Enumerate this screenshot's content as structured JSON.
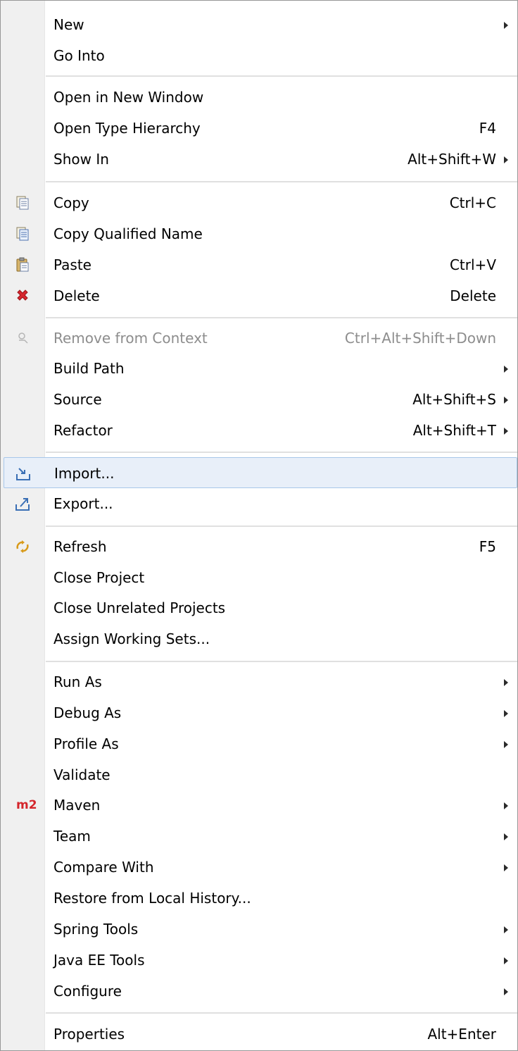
{
  "menu": {
    "items": [
      {
        "label": "New",
        "shortcut": "",
        "submenu": true
      },
      {
        "label": "Go Into",
        "shortcut": "",
        "submenu": false
      },
      {
        "label": "Open in New Window",
        "shortcut": "",
        "submenu": false
      },
      {
        "label": "Open Type Hierarchy",
        "shortcut": "F4",
        "submenu": false
      },
      {
        "label": "Show In",
        "shortcut": "Alt+Shift+W",
        "submenu": true
      },
      {
        "label": "Copy",
        "shortcut": "Ctrl+C",
        "submenu": false,
        "icon": "copy-icon"
      },
      {
        "label": "Copy Qualified Name",
        "shortcut": "",
        "submenu": false,
        "icon": "copy-qualified-name-icon"
      },
      {
        "label": "Paste",
        "shortcut": "Ctrl+V",
        "submenu": false,
        "icon": "paste-icon"
      },
      {
        "label": "Delete",
        "shortcut": "Delete",
        "submenu": false,
        "icon": "delete-icon"
      },
      {
        "label": "Remove from Context",
        "shortcut": "Ctrl+Alt+Shift+Down",
        "submenu": false,
        "disabled": true,
        "icon": "remove-from-context-icon"
      },
      {
        "label": "Build Path",
        "shortcut": "",
        "submenu": true
      },
      {
        "label": "Source",
        "shortcut": "Alt+Shift+S",
        "submenu": true
      },
      {
        "label": "Refactor",
        "shortcut": "Alt+Shift+T",
        "submenu": true
      },
      {
        "label": "Import...",
        "shortcut": "",
        "submenu": false,
        "highlighted": true,
        "icon": "import-icon"
      },
      {
        "label": "Export...",
        "shortcut": "",
        "submenu": false,
        "icon": "export-icon"
      },
      {
        "label": "Refresh",
        "shortcut": "F5",
        "submenu": false,
        "icon": "refresh-icon"
      },
      {
        "label": "Close Project",
        "shortcut": "",
        "submenu": false
      },
      {
        "label": "Close Unrelated Projects",
        "shortcut": "",
        "submenu": false
      },
      {
        "label": "Assign Working Sets...",
        "shortcut": "",
        "submenu": false
      },
      {
        "label": "Run As",
        "shortcut": "",
        "submenu": true
      },
      {
        "label": "Debug As",
        "shortcut": "",
        "submenu": true
      },
      {
        "label": "Profile As",
        "shortcut": "",
        "submenu": true
      },
      {
        "label": "Validate",
        "shortcut": "",
        "submenu": false
      },
      {
        "label": "Maven",
        "shortcut": "",
        "submenu": true,
        "icon_text": "m2"
      },
      {
        "label": "Team",
        "shortcut": "",
        "submenu": true
      },
      {
        "label": "Compare With",
        "shortcut": "",
        "submenu": true
      },
      {
        "label": "Restore from Local History...",
        "shortcut": "",
        "submenu": false
      },
      {
        "label": "Spring Tools",
        "shortcut": "",
        "submenu": true
      },
      {
        "label": "Java EE Tools",
        "shortcut": "",
        "submenu": true
      },
      {
        "label": "Configure",
        "shortcut": "",
        "submenu": true
      },
      {
        "label": "Properties",
        "shortcut": "Alt+Enter",
        "submenu": false
      }
    ]
  },
  "colors": {
    "highlight_bg": "#e8eff9",
    "highlight_border": "#a8c7ea",
    "disabled_text": "#8d8d8d",
    "maven_red": "#d4262c",
    "delete_red": "#d7262e"
  }
}
